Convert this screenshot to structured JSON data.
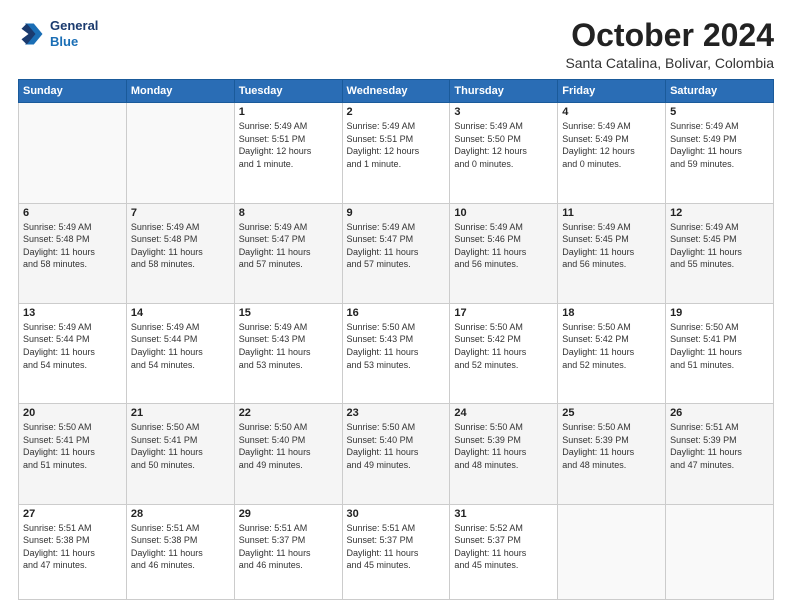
{
  "logo": {
    "line1": "General",
    "line2": "Blue"
  },
  "header": {
    "month": "October 2024",
    "location": "Santa Catalina, Bolivar, Colombia"
  },
  "days_of_week": [
    "Sunday",
    "Monday",
    "Tuesday",
    "Wednesday",
    "Thursday",
    "Friday",
    "Saturday"
  ],
  "weeks": [
    [
      {
        "day": "",
        "info": ""
      },
      {
        "day": "",
        "info": ""
      },
      {
        "day": "1",
        "info": "Sunrise: 5:49 AM\nSunset: 5:51 PM\nDaylight: 12 hours\nand 1 minute."
      },
      {
        "day": "2",
        "info": "Sunrise: 5:49 AM\nSunset: 5:51 PM\nDaylight: 12 hours\nand 1 minute."
      },
      {
        "day": "3",
        "info": "Sunrise: 5:49 AM\nSunset: 5:50 PM\nDaylight: 12 hours\nand 0 minutes."
      },
      {
        "day": "4",
        "info": "Sunrise: 5:49 AM\nSunset: 5:49 PM\nDaylight: 12 hours\nand 0 minutes."
      },
      {
        "day": "5",
        "info": "Sunrise: 5:49 AM\nSunset: 5:49 PM\nDaylight: 11 hours\nand 59 minutes."
      }
    ],
    [
      {
        "day": "6",
        "info": "Sunrise: 5:49 AM\nSunset: 5:48 PM\nDaylight: 11 hours\nand 58 minutes."
      },
      {
        "day": "7",
        "info": "Sunrise: 5:49 AM\nSunset: 5:48 PM\nDaylight: 11 hours\nand 58 minutes."
      },
      {
        "day": "8",
        "info": "Sunrise: 5:49 AM\nSunset: 5:47 PM\nDaylight: 11 hours\nand 57 minutes."
      },
      {
        "day": "9",
        "info": "Sunrise: 5:49 AM\nSunset: 5:47 PM\nDaylight: 11 hours\nand 57 minutes."
      },
      {
        "day": "10",
        "info": "Sunrise: 5:49 AM\nSunset: 5:46 PM\nDaylight: 11 hours\nand 56 minutes."
      },
      {
        "day": "11",
        "info": "Sunrise: 5:49 AM\nSunset: 5:45 PM\nDaylight: 11 hours\nand 56 minutes."
      },
      {
        "day": "12",
        "info": "Sunrise: 5:49 AM\nSunset: 5:45 PM\nDaylight: 11 hours\nand 55 minutes."
      }
    ],
    [
      {
        "day": "13",
        "info": "Sunrise: 5:49 AM\nSunset: 5:44 PM\nDaylight: 11 hours\nand 54 minutes."
      },
      {
        "day": "14",
        "info": "Sunrise: 5:49 AM\nSunset: 5:44 PM\nDaylight: 11 hours\nand 54 minutes."
      },
      {
        "day": "15",
        "info": "Sunrise: 5:49 AM\nSunset: 5:43 PM\nDaylight: 11 hours\nand 53 minutes."
      },
      {
        "day": "16",
        "info": "Sunrise: 5:50 AM\nSunset: 5:43 PM\nDaylight: 11 hours\nand 53 minutes."
      },
      {
        "day": "17",
        "info": "Sunrise: 5:50 AM\nSunset: 5:42 PM\nDaylight: 11 hours\nand 52 minutes."
      },
      {
        "day": "18",
        "info": "Sunrise: 5:50 AM\nSunset: 5:42 PM\nDaylight: 11 hours\nand 52 minutes."
      },
      {
        "day": "19",
        "info": "Sunrise: 5:50 AM\nSunset: 5:41 PM\nDaylight: 11 hours\nand 51 minutes."
      }
    ],
    [
      {
        "day": "20",
        "info": "Sunrise: 5:50 AM\nSunset: 5:41 PM\nDaylight: 11 hours\nand 51 minutes."
      },
      {
        "day": "21",
        "info": "Sunrise: 5:50 AM\nSunset: 5:41 PM\nDaylight: 11 hours\nand 50 minutes."
      },
      {
        "day": "22",
        "info": "Sunrise: 5:50 AM\nSunset: 5:40 PM\nDaylight: 11 hours\nand 49 minutes."
      },
      {
        "day": "23",
        "info": "Sunrise: 5:50 AM\nSunset: 5:40 PM\nDaylight: 11 hours\nand 49 minutes."
      },
      {
        "day": "24",
        "info": "Sunrise: 5:50 AM\nSunset: 5:39 PM\nDaylight: 11 hours\nand 48 minutes."
      },
      {
        "day": "25",
        "info": "Sunrise: 5:50 AM\nSunset: 5:39 PM\nDaylight: 11 hours\nand 48 minutes."
      },
      {
        "day": "26",
        "info": "Sunrise: 5:51 AM\nSunset: 5:39 PM\nDaylight: 11 hours\nand 47 minutes."
      }
    ],
    [
      {
        "day": "27",
        "info": "Sunrise: 5:51 AM\nSunset: 5:38 PM\nDaylight: 11 hours\nand 47 minutes."
      },
      {
        "day": "28",
        "info": "Sunrise: 5:51 AM\nSunset: 5:38 PM\nDaylight: 11 hours\nand 46 minutes."
      },
      {
        "day": "29",
        "info": "Sunrise: 5:51 AM\nSunset: 5:37 PM\nDaylight: 11 hours\nand 46 minutes."
      },
      {
        "day": "30",
        "info": "Sunrise: 5:51 AM\nSunset: 5:37 PM\nDaylight: 11 hours\nand 45 minutes."
      },
      {
        "day": "31",
        "info": "Sunrise: 5:52 AM\nSunset: 5:37 PM\nDaylight: 11 hours\nand 45 minutes."
      },
      {
        "day": "",
        "info": ""
      },
      {
        "day": "",
        "info": ""
      }
    ]
  ]
}
